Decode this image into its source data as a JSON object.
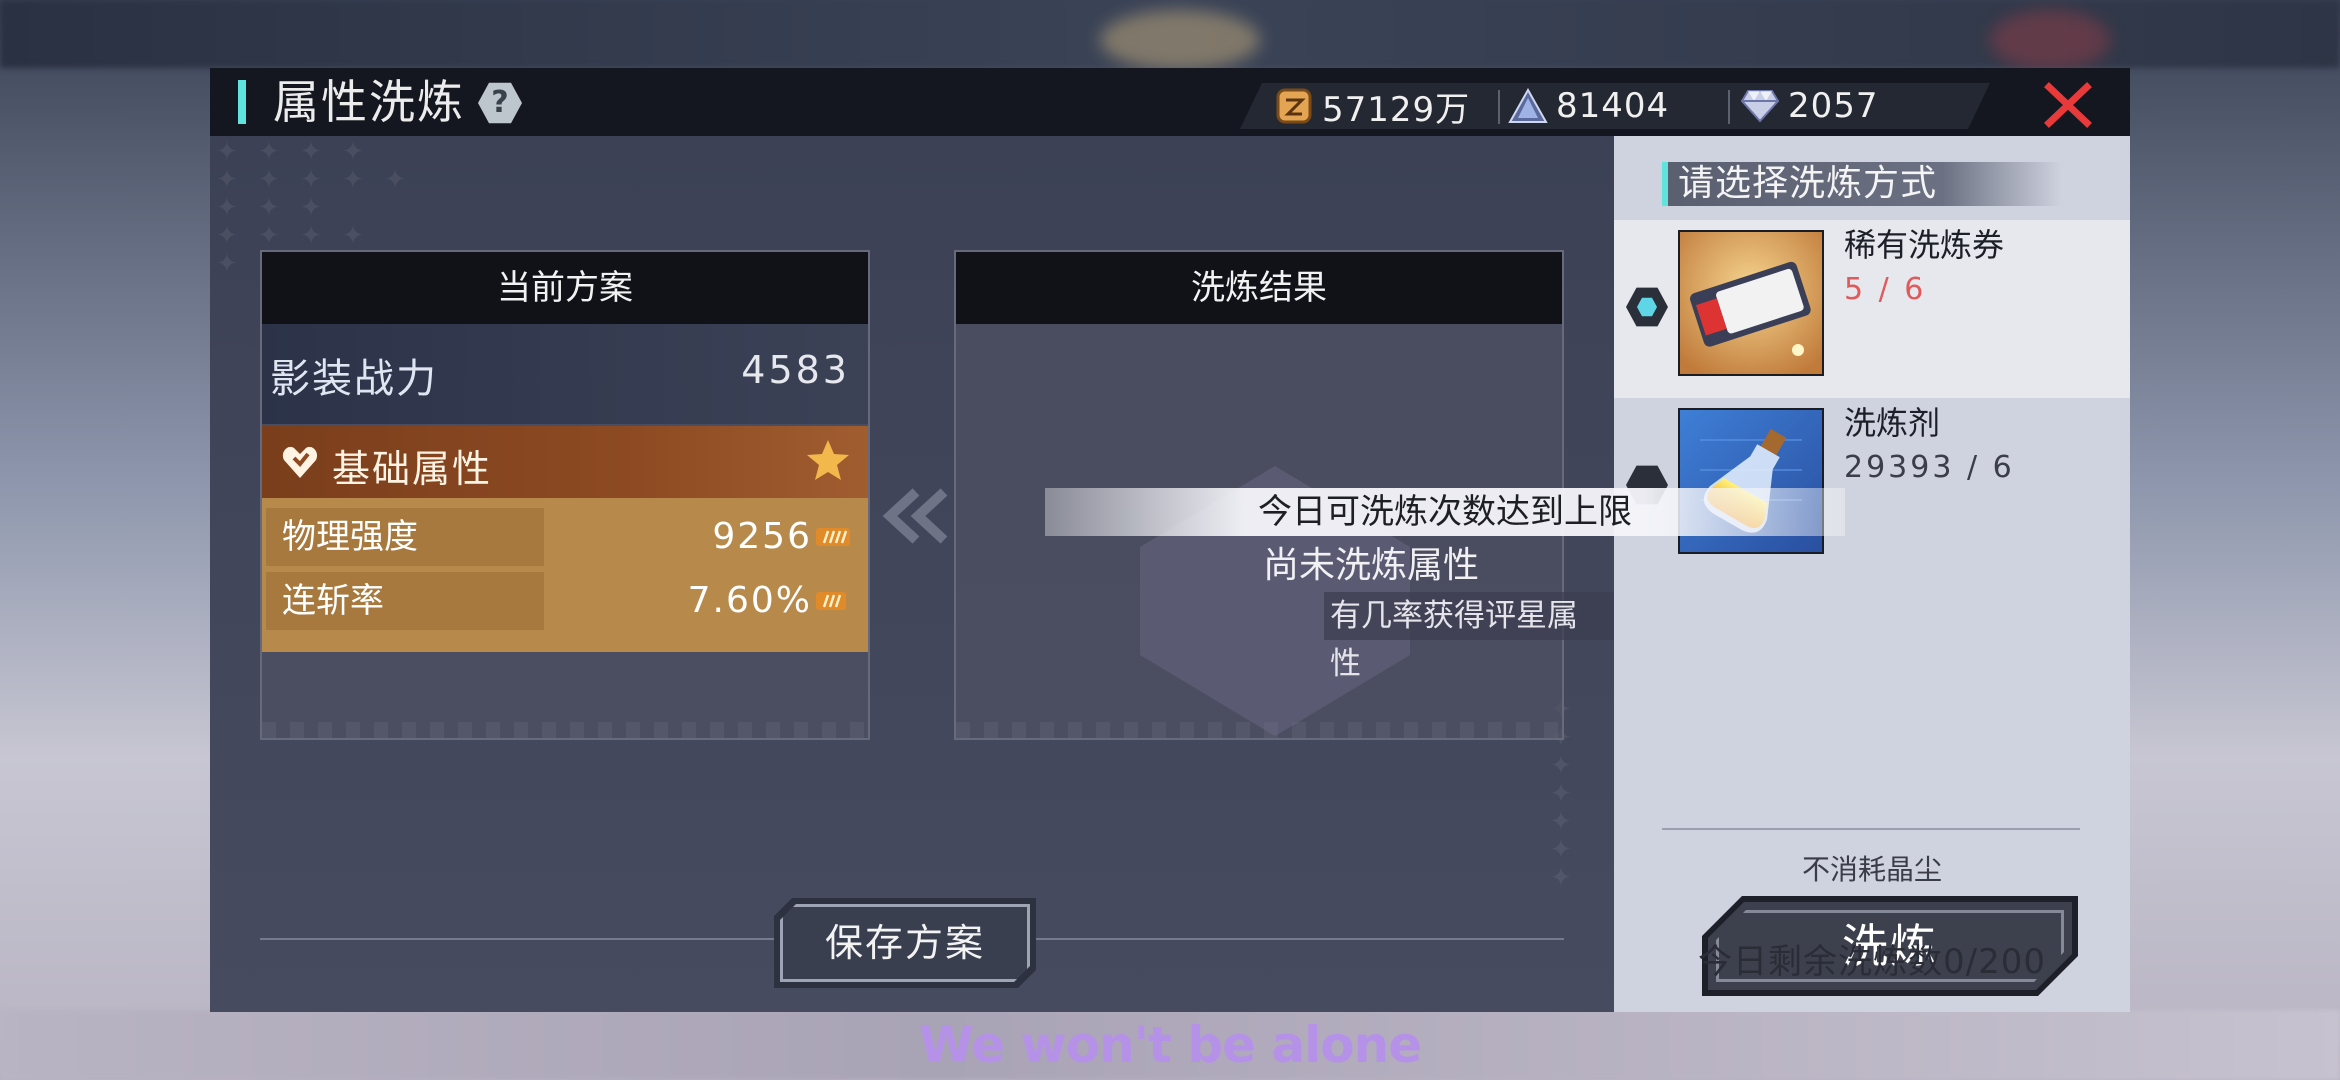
{
  "header": {
    "title": "属性洗炼",
    "help_symbol": "?",
    "currencies": [
      {
        "icon": "gold-coin-icon",
        "value": "57129万"
      },
      {
        "icon": "crystal-pyramid-icon",
        "value": "81404"
      },
      {
        "icon": "diamond-gem-icon",
        "value": "2057"
      }
    ]
  },
  "current_plan": {
    "header": "当前方案",
    "power_label": "影装战力",
    "power_value": "4583",
    "attr_header": "基础属性",
    "attributes": [
      {
        "name": "物理强度",
        "value": "9256"
      },
      {
        "name": "连斩率",
        "value": "7.60%"
      }
    ]
  },
  "result": {
    "header": "洗炼结果",
    "message": "尚未洗炼属性",
    "sub_message": "有几率获得评星属性"
  },
  "notice": "今日可洗炼次数达到上限",
  "save_button": "保存方案",
  "methods": {
    "header": "请选择洗炼方式",
    "items": [
      {
        "name": "稀有洗炼券",
        "count": "5 / 6",
        "selected": true,
        "count_color": "#e05a5a"
      },
      {
        "name": "洗炼剂",
        "count": "29393 / 6",
        "selected": false,
        "count_color": "#3b3d48"
      }
    ]
  },
  "footer": {
    "no_cost": "不消耗晶尘",
    "wash_button": "洗炼",
    "remaining": "今日剩余洗炼数0/200"
  },
  "subtitle": "We won't be alone",
  "colors": {
    "accent": "#5fe3dc",
    "close": "#e83a3a",
    "star": "#f2b84b"
  }
}
